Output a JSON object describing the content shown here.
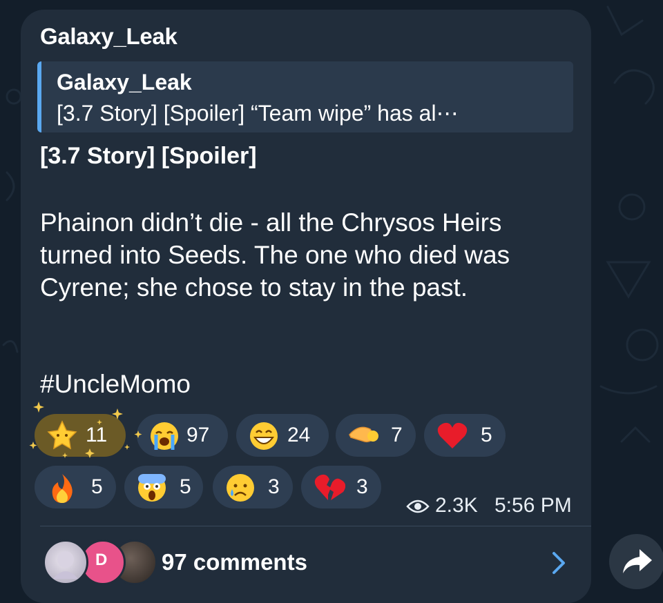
{
  "post": {
    "author": "Galaxy_Leak",
    "quote": {
      "author": "Galaxy_Leak",
      "text": "[3.7 Story] [Spoiler]  “Team wipe” has al⋯"
    },
    "title": "[3.7 Story] [Spoiler]",
    "body": "Phainon didn’t die - all the Chrysos Heirs turned into Seeds. The one who died was Cyrene; she chose to stay in the past.",
    "hashtag": "#UncleMomo"
  },
  "reactions": [
    {
      "emoji": "star-struck",
      "count": "11",
      "selected": true
    },
    {
      "emoji": "loudly-crying-face",
      "count": "97"
    },
    {
      "emoji": "grinning-face",
      "count": "24"
    },
    {
      "emoji": "saluting-hand",
      "count": "7"
    },
    {
      "emoji": "red-heart",
      "count": "5"
    },
    {
      "emoji": "fire",
      "count": "5"
    },
    {
      "emoji": "screaming-face",
      "count": "5"
    },
    {
      "emoji": "crying-face",
      "count": "3"
    },
    {
      "emoji": "broken-heart",
      "count": "3"
    }
  ],
  "meta": {
    "views": "2.3K",
    "time": "5:56 PM"
  },
  "comments": {
    "label": "97 comments",
    "avatar_initial": "D"
  },
  "colors": {
    "background": "#131e2a",
    "bubble": "#212d3b",
    "accent": "#5aa8f0",
    "reaction_bg": "#2e3e52",
    "reaction_selected": "#6b5a26"
  }
}
